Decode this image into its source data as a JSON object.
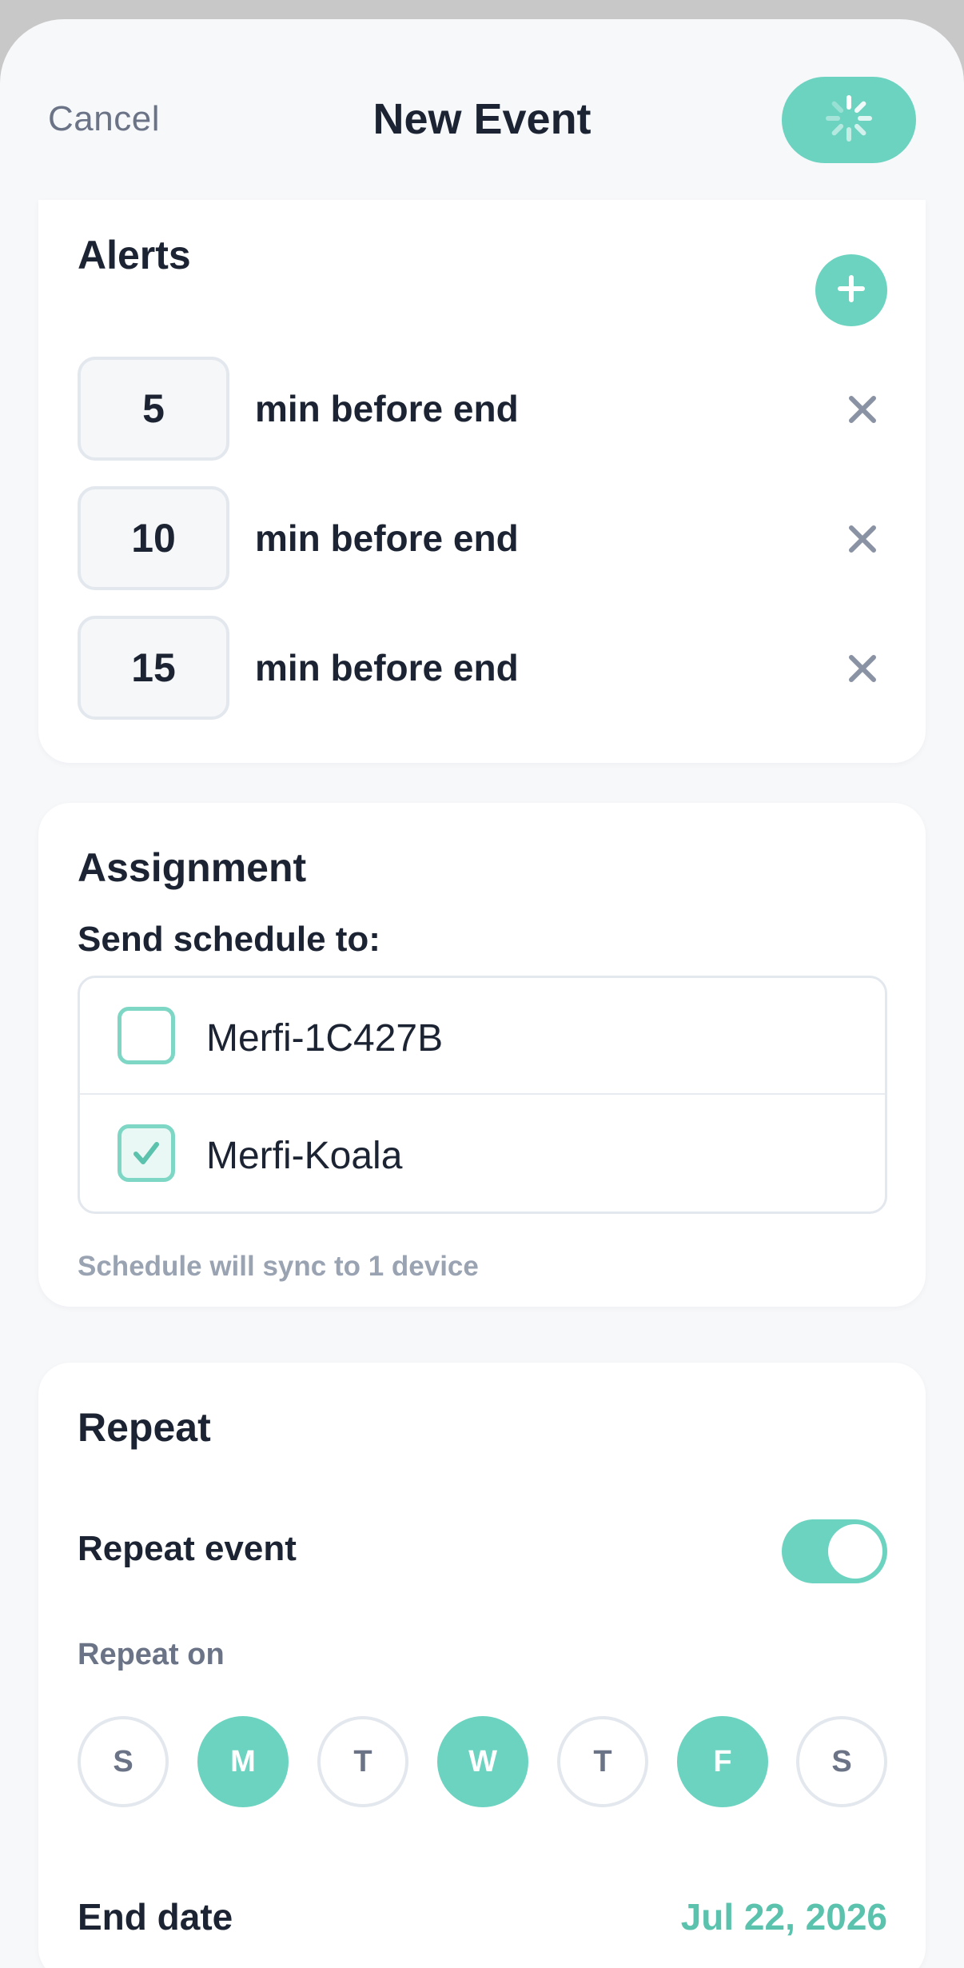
{
  "header": {
    "cancel_label": "Cancel",
    "title": "New Event",
    "save_state": "loading"
  },
  "alerts": {
    "title": "Alerts",
    "add_icon": "plus-icon",
    "items": [
      {
        "minutes": "5",
        "label": "min before end"
      },
      {
        "minutes": "10",
        "label": "min before end"
      },
      {
        "minutes": "15",
        "label": "min before end"
      }
    ]
  },
  "assignment": {
    "title": "Assignment",
    "send_label": "Send schedule to:",
    "devices": [
      {
        "name": "Merfi-1C427B",
        "checked": false
      },
      {
        "name": "Merfi-Koala",
        "checked": true
      }
    ],
    "sync_note": "Schedule will sync to 1 device"
  },
  "repeat": {
    "title": "Repeat",
    "repeat_event_label": "Repeat event",
    "repeat_enabled": true,
    "repeat_on_label": "Repeat on",
    "days": [
      {
        "letter": "S",
        "on": false
      },
      {
        "letter": "M",
        "on": true
      },
      {
        "letter": "T",
        "on": false
      },
      {
        "letter": "W",
        "on": true
      },
      {
        "letter": "T",
        "on": false
      },
      {
        "letter": "F",
        "on": true
      },
      {
        "letter": "S",
        "on": false
      }
    ],
    "end_date_label": "End date",
    "end_date_value": "Jul 22, 2026"
  },
  "colors": {
    "accent": "#6bd3c0",
    "accent_text": "#5bc2ad",
    "text_primary": "#1c2433",
    "text_secondary": "#6b7487",
    "text_muted": "#9aa3b2"
  }
}
